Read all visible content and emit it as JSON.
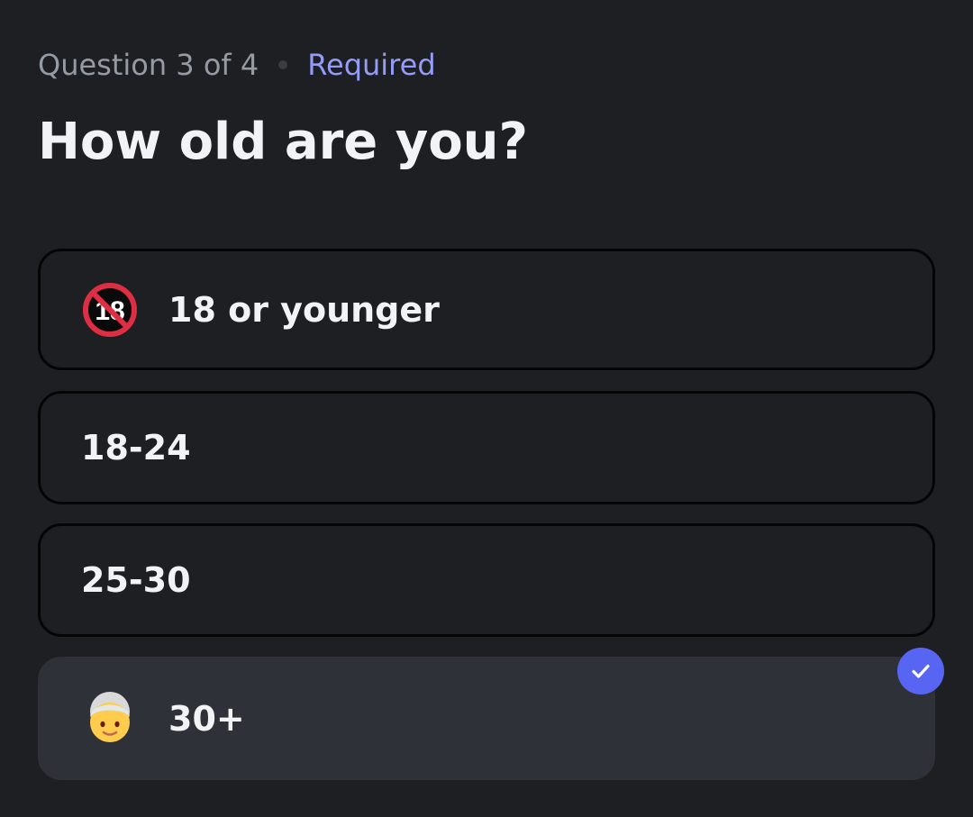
{
  "header": {
    "progress": "Question 3 of 4",
    "required_label": "Required"
  },
  "question": {
    "title": "How old are you?"
  },
  "options": [
    {
      "label": "18 or younger",
      "icon": "no-under-eighteen-icon",
      "selected": false
    },
    {
      "label": "18-24",
      "icon": "",
      "selected": false
    },
    {
      "label": "25-30",
      "icon": "",
      "selected": false
    },
    {
      "label": "30+",
      "icon": "older-person-icon",
      "selected": true
    }
  ],
  "colors": {
    "accent": "#5865f2",
    "required": "#949cf7",
    "background": "#1e1f22",
    "selected_bg": "#2f3138"
  }
}
